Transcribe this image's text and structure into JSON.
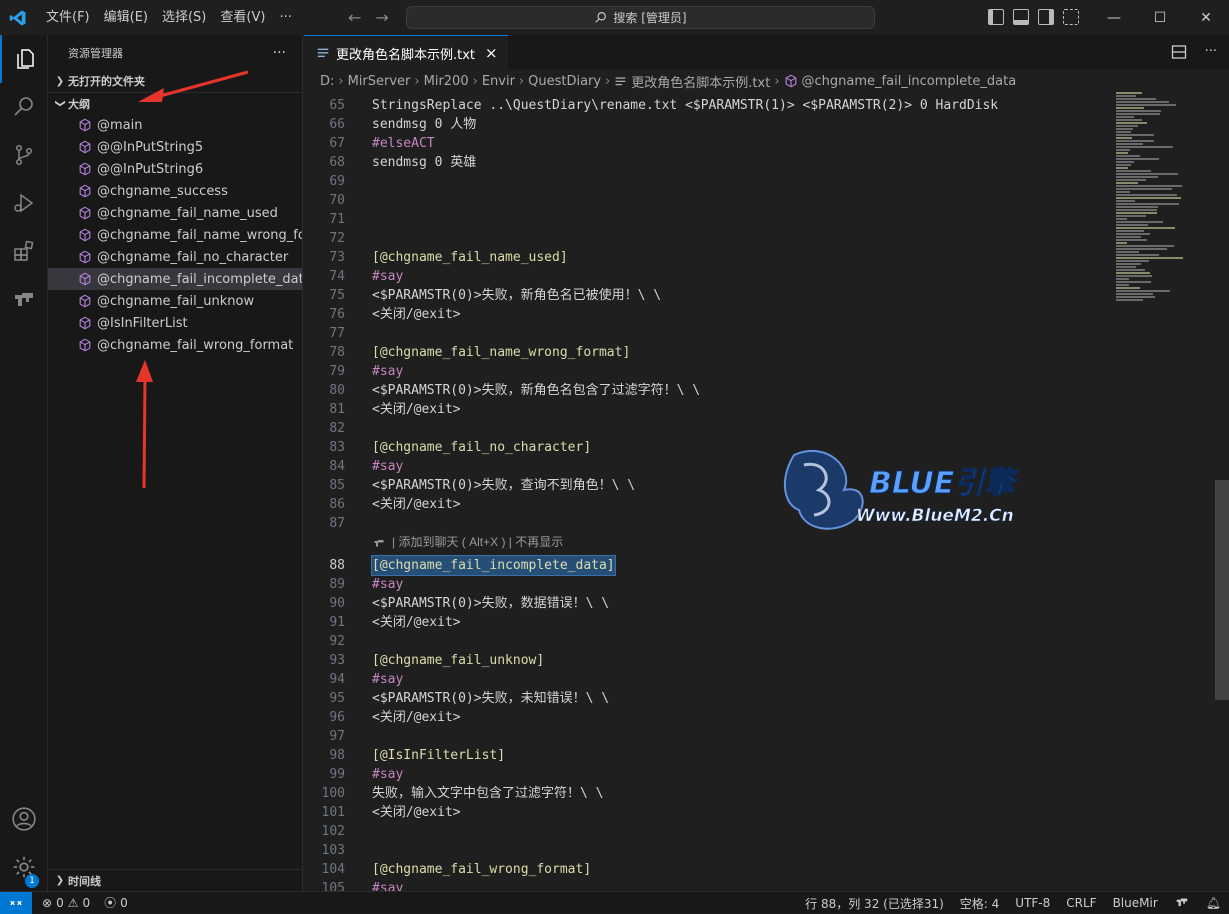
{
  "titlebar": {
    "menus": [
      "文件(F)",
      "编辑(E)",
      "选择(S)",
      "查看(V)",
      "···"
    ],
    "search_label": "搜索 [管理员]"
  },
  "sidebar": {
    "title": "资源管理器",
    "more": "···",
    "open_folder_section": "无打开的文件夹",
    "outline_section": "大纲",
    "outline_items": [
      "@main",
      "@@InPutString5",
      "@@InPutString6",
      "@chgname_success",
      "@chgname_fail_name_used",
      "@chgname_fail_name_wrong_for...",
      "@chgname_fail_no_character",
      "@chgname_fail_incomplete_data",
      "@chgname_fail_unknow",
      "@IsInFilterList",
      "@chgname_fail_wrong_format"
    ],
    "timeline_section": "时间线"
  },
  "editor": {
    "tab_title": "更改角色名脚本示例.txt",
    "tab_close": "×",
    "breadcrumbs": [
      "D:",
      "MirServer",
      "Mir200",
      "Envir",
      "QuestDiary",
      "更改角色名脚本示例.txt",
      "@chgname_fail_incomplete_data"
    ],
    "lines": [
      {
        "n": "65",
        "t": "StringsReplace ..\\QuestDiary\\rename.txt <$PARAMSTR(1)> <$PARAMSTR(2)> 0 HardDisk",
        "c": "def"
      },
      {
        "n": "66",
        "t": "sendmsg 0 人物",
        "c": "def"
      },
      {
        "n": "67",
        "t": "#elseACT",
        "c": "kw"
      },
      {
        "n": "68",
        "t": "sendmsg 0 英雄",
        "c": "def"
      },
      {
        "n": "69",
        "t": "",
        "c": "def"
      },
      {
        "n": "70",
        "t": "",
        "c": "def"
      },
      {
        "n": "71",
        "t": "",
        "c": "def"
      },
      {
        "n": "72",
        "t": "",
        "c": "def"
      },
      {
        "n": "73",
        "t": "[@chgname_fail_name_used]",
        "c": "lbl"
      },
      {
        "n": "74",
        "t": "#say",
        "c": "say"
      },
      {
        "n": "75",
        "t": "<$PARAMSTR(0)>失败，新角色名已被使用！\\ \\",
        "c": "def"
      },
      {
        "n": "76",
        "t": "<关闭/@exit>",
        "c": "def"
      },
      {
        "n": "77",
        "t": "",
        "c": "def"
      },
      {
        "n": "78",
        "t": "[@chgname_fail_name_wrong_format]",
        "c": "lbl"
      },
      {
        "n": "79",
        "t": "#say",
        "c": "say"
      },
      {
        "n": "80",
        "t": "<$PARAMSTR(0)>失败，新角色名包含了过滤字符！\\ \\",
        "c": "def"
      },
      {
        "n": "81",
        "t": "<关闭/@exit>",
        "c": "def"
      },
      {
        "n": "82",
        "t": "",
        "c": "def"
      },
      {
        "n": "83",
        "t": "[@chgname_fail_no_character]",
        "c": "lbl"
      },
      {
        "n": "84",
        "t": "#say",
        "c": "say"
      },
      {
        "n": "85",
        "t": "<$PARAMSTR(0)>失败，查询不到角色！\\ \\",
        "c": "def"
      },
      {
        "n": "86",
        "t": "<关闭/@exit>",
        "c": "def"
      },
      {
        "n": "87",
        "t": "",
        "c": "def"
      },
      {
        "n": "88",
        "t": "[@chgname_fail_incomplete_data]",
        "c": "lbl"
      },
      {
        "n": "89",
        "t": "#say",
        "c": "say"
      },
      {
        "n": "90",
        "t": "<$PARAMSTR(0)>失败，数据错误！\\ \\",
        "c": "def"
      },
      {
        "n": "91",
        "t": "<关闭/@exit>",
        "c": "def"
      },
      {
        "n": "92",
        "t": "",
        "c": "def"
      },
      {
        "n": "93",
        "t": "[@chgname_fail_unknow]",
        "c": "lbl"
      },
      {
        "n": "94",
        "t": "#say",
        "c": "say"
      },
      {
        "n": "95",
        "t": "<$PARAMSTR(0)>失败，未知错误！\\ \\",
        "c": "def"
      },
      {
        "n": "96",
        "t": "<关闭/@exit>",
        "c": "def"
      },
      {
        "n": "97",
        "t": "",
        "c": "def"
      },
      {
        "n": "98",
        "t": "[@IsInFilterList]",
        "c": "lbl"
      },
      {
        "n": "99",
        "t": "#say",
        "c": "say"
      },
      {
        "n": "100",
        "t": "失败，输入文字中包含了过滤字符！\\ \\",
        "c": "def"
      },
      {
        "n": "101",
        "t": "<关闭/@exit>",
        "c": "def"
      },
      {
        "n": "102",
        "t": "",
        "c": "def"
      },
      {
        "n": "103",
        "t": "",
        "c": "def"
      },
      {
        "n": "104",
        "t": "[@chgname_fail_wrong_format]",
        "c": "lbl"
      },
      {
        "n": "105",
        "t": "#say",
        "c": "say"
      }
    ],
    "current_line": "88",
    "codelens": "| 添加到聊天 ( Alt+X ) | 不再显示"
  },
  "watermark": {
    "brand": "BLUE引擎",
    "url": "Www.BlueM2.Cn"
  },
  "statusbar": {
    "errors": "0",
    "warnings": "0",
    "ports": "0",
    "position": "行 88，列 32 (已选择31)",
    "indent": "空格: 4",
    "encoding": "UTF-8",
    "eol": "CRLF",
    "language": "BlueMir"
  },
  "accounts_badge": "1",
  "colors": {
    "accent": "#0078d4",
    "arrow": "#e8352b",
    "label": "#dcdcaa",
    "keyword": "#c586c0"
  }
}
